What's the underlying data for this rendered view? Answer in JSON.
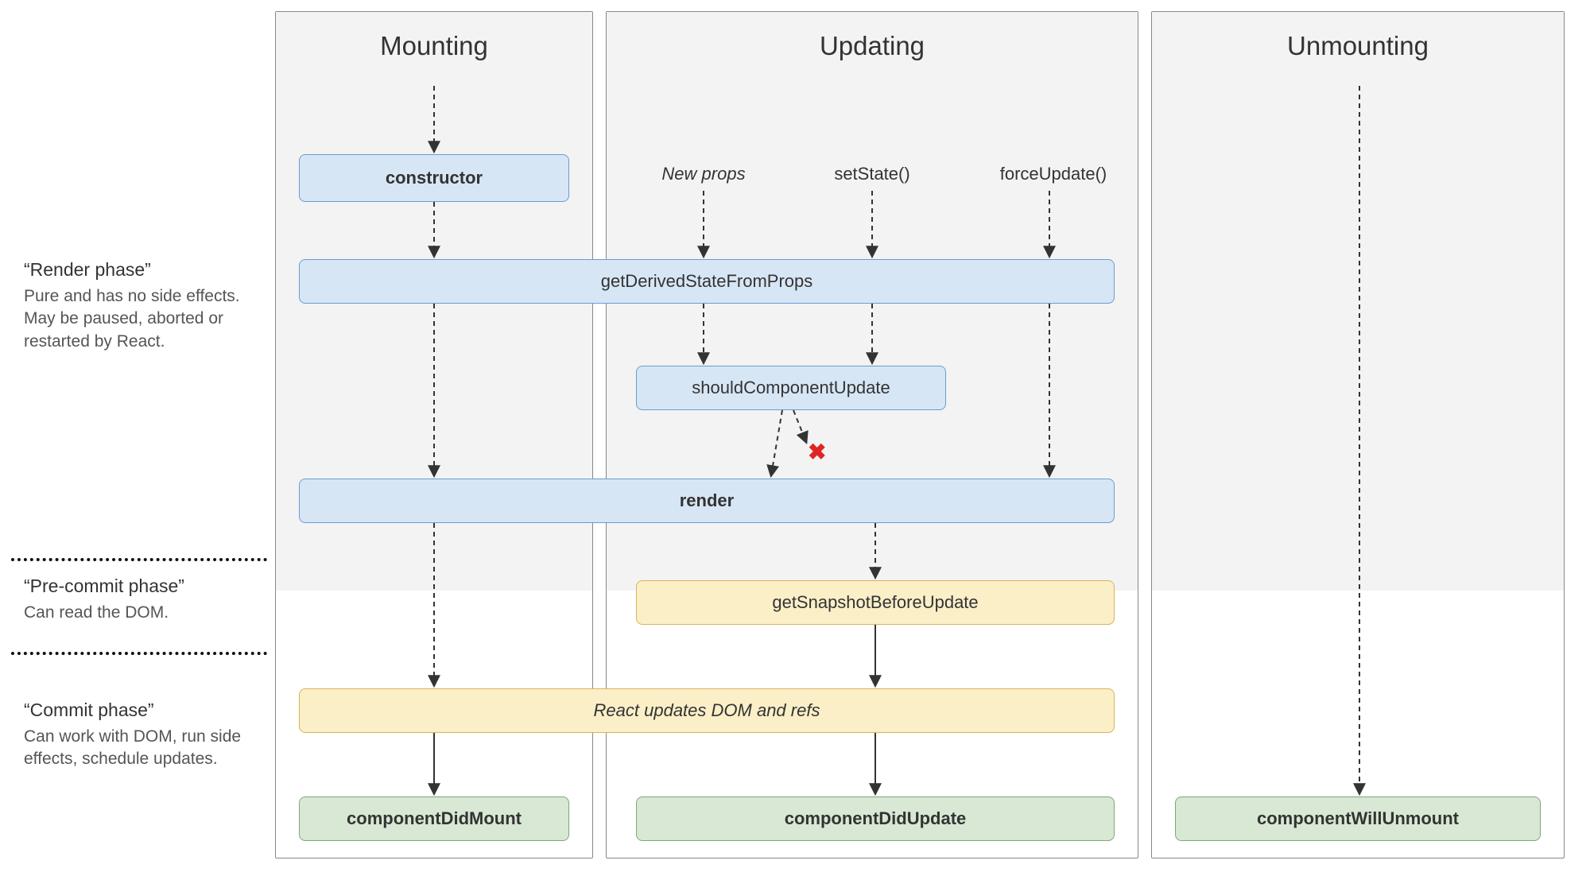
{
  "columns": {
    "mounting": "Mounting",
    "updating": "Updating",
    "unmounting": "Unmounting"
  },
  "phases": {
    "render": {
      "title": "“Render phase”",
      "desc": "Pure and has no side effects. May be paused, aborted or restarted by React."
    },
    "precommit": {
      "title": "“Pre-commit phase”",
      "desc": "Can read the DOM."
    },
    "commit": {
      "title": "“Commit phase”",
      "desc": "Can work with DOM, run side effects, schedule updates."
    }
  },
  "triggers": {
    "newprops": "New props",
    "setstate": "setState()",
    "forceupdate": "forceUpdate()"
  },
  "nodes": {
    "constructor": "constructor",
    "gdsfp": "getDerivedStateFromProps",
    "scu": "shouldComponentUpdate",
    "render": "render",
    "gsbu": "getSnapshotBeforeUpdate",
    "reactupdates": "React updates DOM and refs",
    "cdm": "componentDidMount",
    "cdu": "componentDidUpdate",
    "cwu": "componentWillUnmount"
  },
  "x_mark": "✖"
}
